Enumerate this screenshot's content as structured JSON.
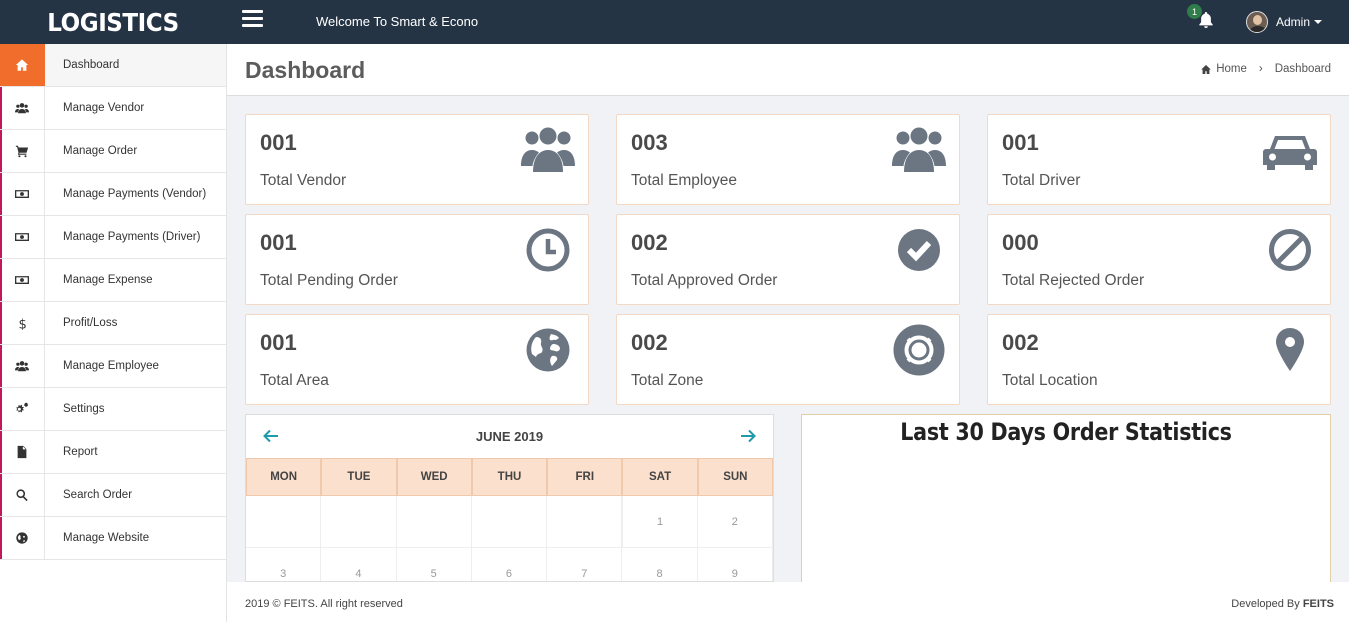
{
  "brand": "LOGISTICS",
  "topbar": {
    "welcome": "Welcome To Smart & Econo",
    "notification_count": "1",
    "user_name": "Admin"
  },
  "sidebar": {
    "items": [
      {
        "label": "Dashboard",
        "icon": "home-icon"
      },
      {
        "label": "Manage Vendor",
        "icon": "users-icon"
      },
      {
        "label": "Manage Order",
        "icon": "cart-icon"
      },
      {
        "label": "Manage Payments (Vendor)",
        "icon": "money-icon"
      },
      {
        "label": "Manage Payments (Driver)",
        "icon": "money-icon"
      },
      {
        "label": "Manage Expense",
        "icon": "money-icon"
      },
      {
        "label": "Profit/Loss",
        "icon": "dollar-icon"
      },
      {
        "label": "Manage Employee",
        "icon": "users-icon"
      },
      {
        "label": "Settings",
        "icon": "gears-icon"
      },
      {
        "label": "Report",
        "icon": "file-icon"
      },
      {
        "label": "Search Order",
        "icon": "search-icon"
      },
      {
        "label": "Manage Website",
        "icon": "globe-icon"
      }
    ]
  },
  "header": {
    "title": "Dashboard",
    "breadcrumb_home": "Home",
    "breadcrumb_current": "Dashboard"
  },
  "cards": [
    {
      "value": "001",
      "label": "Total Vendor",
      "icon": "users-icon"
    },
    {
      "value": "003",
      "label": "Total Employee",
      "icon": "users-icon"
    },
    {
      "value": "001",
      "label": "Total Driver",
      "icon": "car-icon"
    },
    {
      "value": "001",
      "label": "Total Pending Order",
      "icon": "clock-icon"
    },
    {
      "value": "002",
      "label": "Total Approved Order",
      "icon": "check-circle-icon"
    },
    {
      "value": "000",
      "label": "Total Rejected Order",
      "icon": "ban-icon"
    },
    {
      "value": "001",
      "label": "Total Area",
      "icon": "globe-icon"
    },
    {
      "value": "002",
      "label": "Total Zone",
      "icon": "lifebuoy-icon"
    },
    {
      "value": "002",
      "label": "Total Location",
      "icon": "map-marker-icon"
    }
  ],
  "calendar": {
    "month_title": "JUNE 2019",
    "weekdays": [
      "MON",
      "TUE",
      "WED",
      "THU",
      "FRI",
      "SAT",
      "SUN"
    ],
    "weeks": [
      [
        "",
        "",
        "",
        "",
        "",
        "1",
        "2"
      ],
      [
        "3",
        "4",
        "5",
        "6",
        "7",
        "8",
        "9"
      ]
    ]
  },
  "stats_panel": {
    "title": "Last 30 Days Order Statistics"
  },
  "footer": {
    "copyright": "2019 © FEITS. All right reserved",
    "developed_by_prefix": "Developed By",
    "developer": "FEITS"
  },
  "colors": {
    "topbar": "#253445",
    "accent": "#f06d2b",
    "sidebar_stripe": "#c2185b",
    "card_border": "#f3d8c4",
    "icon_gray": "#6c7683",
    "calendar_header": "#fbe0cd",
    "calendar_arrow": "#1f9aa8"
  }
}
